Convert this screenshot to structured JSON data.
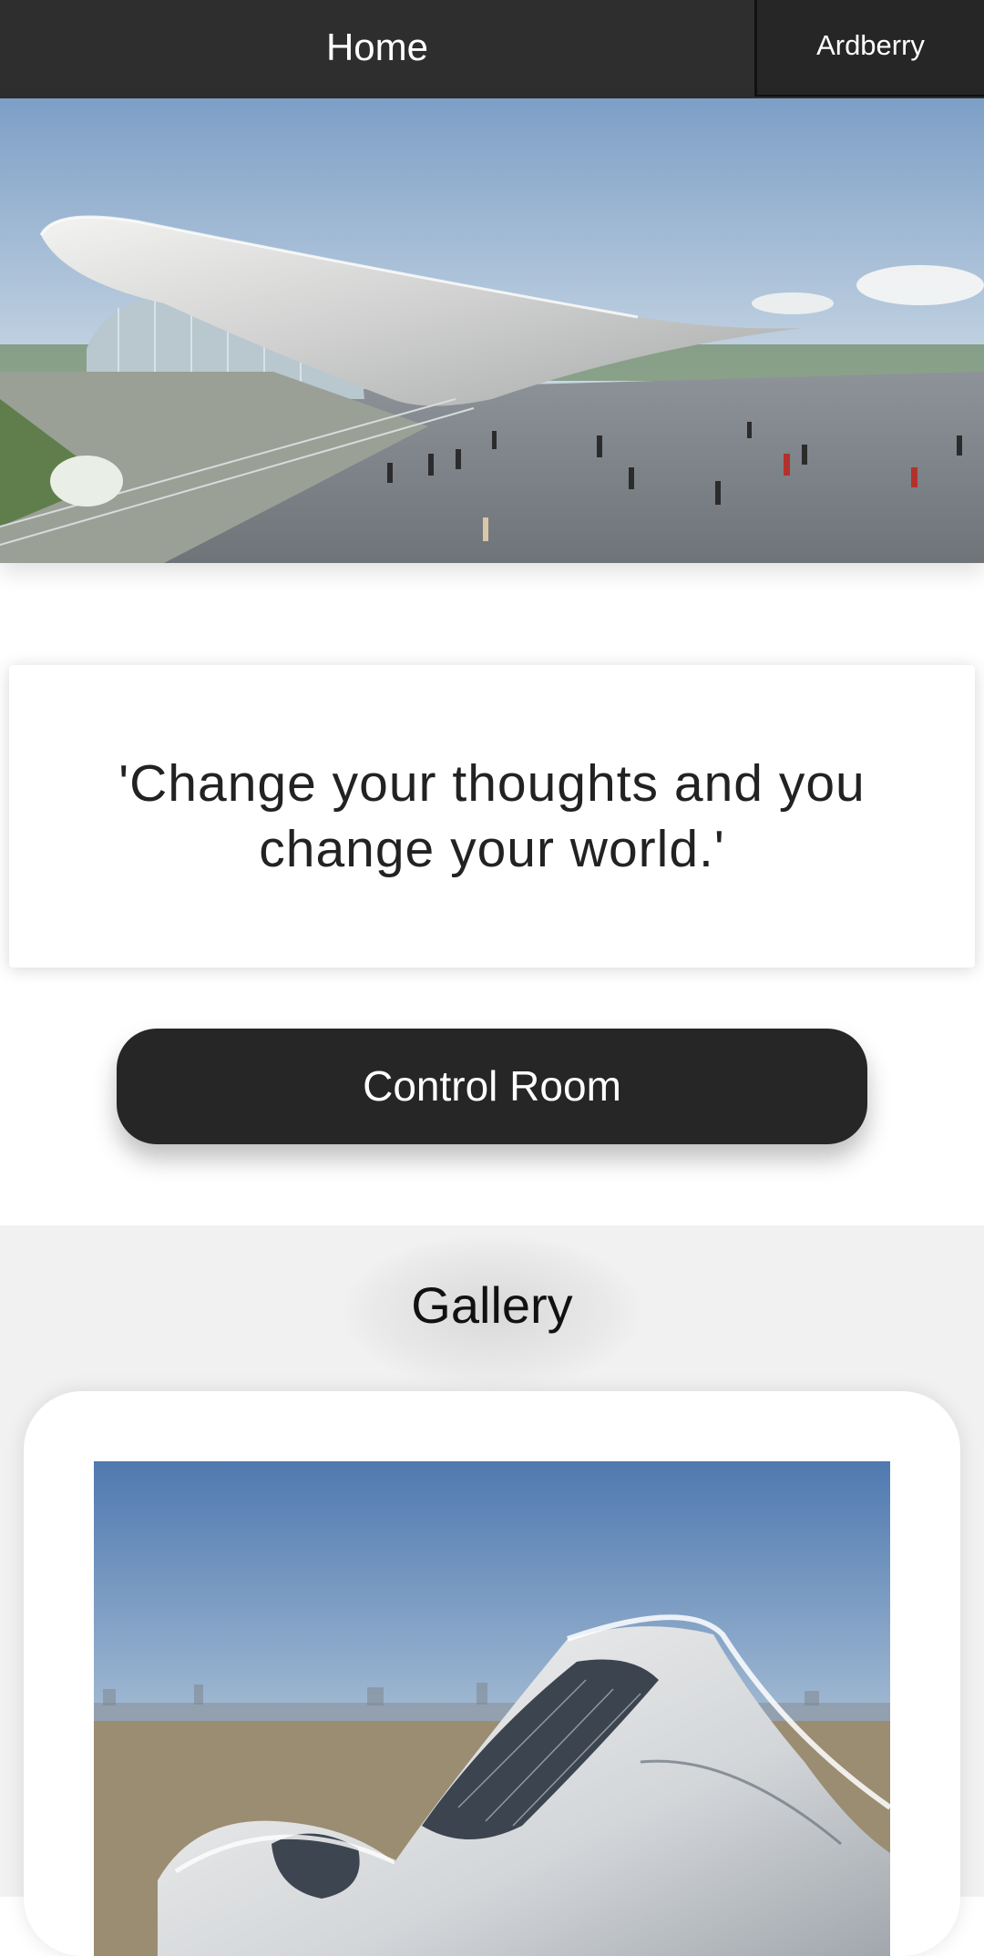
{
  "header": {
    "title": "Home",
    "brand": "Ardberry"
  },
  "quote": {
    "text": "'Change your thoughts and you change your world.'"
  },
  "actions": {
    "control_room_label": "Control Room"
  },
  "gallery": {
    "title": "Gallery"
  },
  "colors": {
    "header_bg": "#2e2e2e",
    "button_bg": "#262626",
    "gallery_bg": "#f1f1f1"
  }
}
